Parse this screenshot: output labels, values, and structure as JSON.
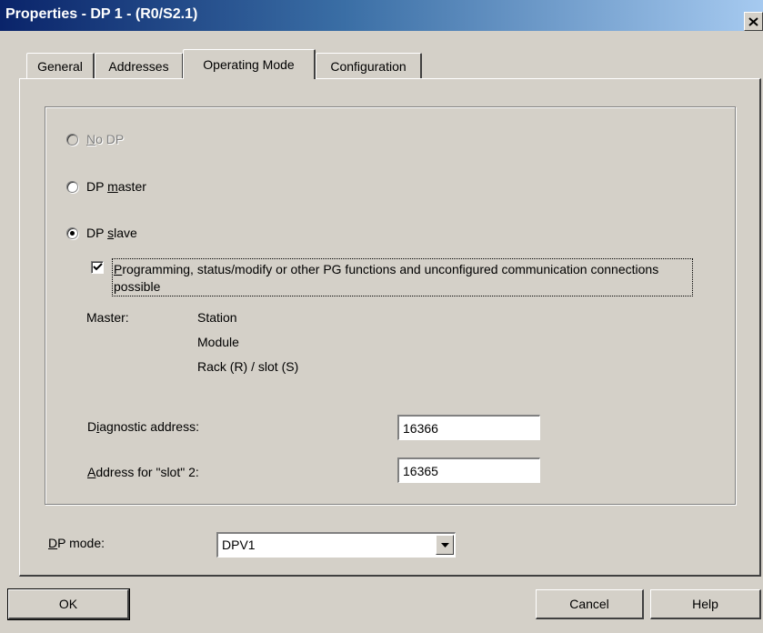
{
  "window": {
    "title": "Properties - DP 1 - (R0/S2.1)",
    "close_icon": "close-icon"
  },
  "tabs": [
    {
      "label": "General",
      "active": false
    },
    {
      "label": "Addresses",
      "active": false
    },
    {
      "label": "Operating Mode",
      "active": true
    },
    {
      "label": "Configuration",
      "active": false
    }
  ],
  "operating_mode": {
    "options": [
      {
        "prefix": "",
        "mnemonic": "N",
        "suffix": "o DP",
        "selected": false,
        "enabled": false
      },
      {
        "prefix": "DP ",
        "mnemonic": "m",
        "suffix": "aster",
        "selected": false,
        "enabled": true
      },
      {
        "prefix": "DP ",
        "mnemonic": "s",
        "suffix": "lave",
        "selected": true,
        "enabled": true
      }
    ],
    "pg_functions": {
      "checked": true,
      "mnemonic": "P",
      "label_rest": "rogramming, status/modify or other PG functions and unconfigured communication connections possible"
    },
    "master": {
      "label": "Master:",
      "station": "Station",
      "module": "Module",
      "rack_slot": "Rack (R) / slot (S)"
    },
    "diagnostic_address": {
      "label_prefix": "D",
      "mnemonic": "i",
      "label_rest": "agnostic address:",
      "value": "16366"
    },
    "slot_address": {
      "label_prefix": "",
      "mnemonic": "A",
      "label_rest": "ddress for \"slot\" 2:",
      "value": "16365"
    }
  },
  "dp_mode": {
    "mnemonic": "D",
    "label_rest": "P mode:",
    "selected": "DPV1"
  },
  "buttons": {
    "ok": "OK",
    "cancel": "Cancel",
    "help": "Help"
  }
}
